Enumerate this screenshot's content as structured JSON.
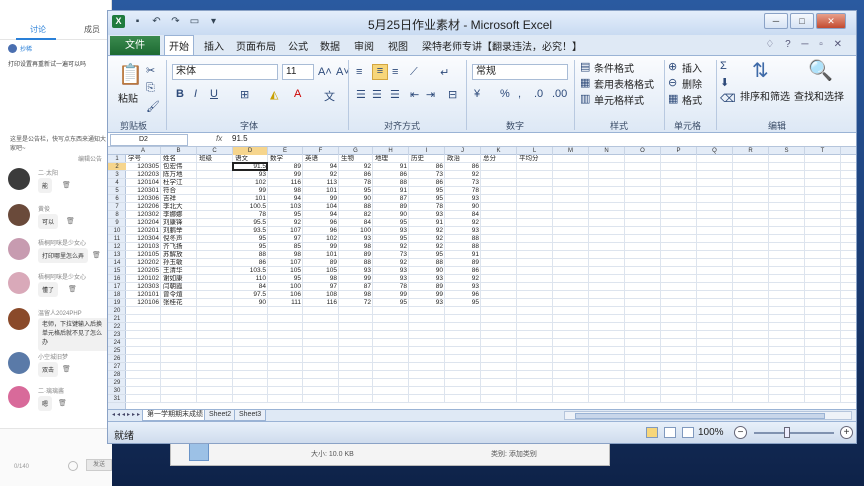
{
  "chat": {
    "tabs": [
      "讨论",
      "成员"
    ],
    "first_msg": {
      "name": "抄稀",
      "text": "打印设置再重新试一遍可以吗"
    },
    "notice": "这里是公告栏，快写点东西来通知大家吧~",
    "notice_btn": "编辑公告",
    "messages": [
      {
        "name": "二·太阳",
        "text": "能"
      },
      {
        "name": "黄俊",
        "text": "可以"
      },
      {
        "name": "梧桐阿咪是少女心",
        "text": "打印哪里怎么弄"
      },
      {
        "name": "梧桐阿咪是少女心",
        "text": "懂了"
      },
      {
        "name": "温留人2024PHP",
        "text": "老师，下拉键输入后换单元格后就不见了怎么办"
      },
      {
        "name": "小空城旧梦",
        "text": "双击"
      },
      {
        "name": "二·璃璃酱",
        "text": "嗯"
      }
    ],
    "counter": "0/140",
    "send_label": "发送"
  },
  "bg_window": {
    "size": "大小: 10.0 KB",
    "type": "类别: 添加类别"
  },
  "excel": {
    "title": "5月25日作业素材 - Microsoft Excel",
    "menu": [
      "文件",
      "开始",
      "插入",
      "页面布局",
      "公式",
      "数据",
      "审阅",
      "视图",
      "梁特老师专讲【翻录违法，必究！】"
    ],
    "ribbon": {
      "paste": "粘贴",
      "font_name": "宋体",
      "font_size": "11",
      "number_format": "常规",
      "conditional_format": "条件格式",
      "table_format": "套用表格格式",
      "cell_style": "单元格样式",
      "insert": "插入",
      "delete": "删除",
      "format": "格式",
      "sort_filter": "排序和筛选",
      "find_select": "查找和选择",
      "groups": [
        "剪贴板",
        "字体",
        "对齐方式",
        "数字",
        "样式",
        "单元格",
        "编辑"
      ]
    },
    "name_box": "D2",
    "fx": "fx",
    "formula_value": "91.5",
    "columns": [
      "A",
      "B",
      "C",
      "D",
      "E",
      "F",
      "G",
      "H",
      "I",
      "J",
      "K",
      "L",
      "M",
      "N",
      "O",
      "P",
      "Q",
      "R",
      "S",
      "T"
    ],
    "headers": [
      "学号",
      "姓名",
      "班级",
      "语文",
      "数学",
      "英语",
      "生物",
      "地理",
      "历史",
      "政治",
      "总分",
      "平均分"
    ],
    "rows": [
      [
        "120305",
        "包宏伟",
        "",
        "91.5",
        "89",
        "94",
        "92",
        "91",
        "86",
        "86"
      ],
      [
        "120203",
        "陈万地",
        "",
        "93",
        "99",
        "92",
        "86",
        "86",
        "73",
        "92"
      ],
      [
        "120104",
        "杜学江",
        "",
        "102",
        "116",
        "113",
        "78",
        "88",
        "86",
        "73"
      ],
      [
        "120301",
        "符合",
        "",
        "99",
        "98",
        "101",
        "95",
        "91",
        "95",
        "78"
      ],
      [
        "120306",
        "吉祥",
        "",
        "101",
        "94",
        "99",
        "90",
        "87",
        "95",
        "93"
      ],
      [
        "120206",
        "李北大",
        "",
        "100.5",
        "103",
        "104",
        "88",
        "89",
        "78",
        "90"
      ],
      [
        "120302",
        "李娜娜",
        "",
        "78",
        "95",
        "94",
        "82",
        "90",
        "93",
        "84"
      ],
      [
        "120204",
        "刘康锋",
        "",
        "95.5",
        "92",
        "96",
        "84",
        "95",
        "91",
        "92"
      ],
      [
        "120201",
        "刘鹏举",
        "",
        "93.5",
        "107",
        "96",
        "100",
        "93",
        "92",
        "93"
      ],
      [
        "120304",
        "倪冬声",
        "",
        "95",
        "97",
        "102",
        "93",
        "95",
        "92",
        "88"
      ],
      [
        "120103",
        "齐飞扬",
        "",
        "95",
        "85",
        "99",
        "98",
        "92",
        "92",
        "88"
      ],
      [
        "120105",
        "苏解放",
        "",
        "88",
        "98",
        "101",
        "89",
        "73",
        "95",
        "91"
      ],
      [
        "120202",
        "孙玉敏",
        "",
        "86",
        "107",
        "89",
        "88",
        "92",
        "88",
        "89"
      ],
      [
        "120205",
        "王清华",
        "",
        "103.5",
        "105",
        "105",
        "93",
        "93",
        "90",
        "86"
      ],
      [
        "120102",
        "谢如康",
        "",
        "110",
        "95",
        "98",
        "99",
        "93",
        "93",
        "92"
      ],
      [
        "120303",
        "闫朝霞",
        "",
        "84",
        "100",
        "97",
        "87",
        "78",
        "89",
        "93"
      ],
      [
        "120101",
        "曾令煊",
        "",
        "97.5",
        "106",
        "108",
        "98",
        "99",
        "99",
        "96"
      ],
      [
        "120106",
        "张桂花",
        "",
        "90",
        "111",
        "116",
        "72",
        "95",
        "93",
        "95"
      ]
    ],
    "sheets": [
      "第一学期期末成绩",
      "Sheet2",
      "Sheet3"
    ],
    "status": "就绪",
    "zoom": "100%"
  }
}
